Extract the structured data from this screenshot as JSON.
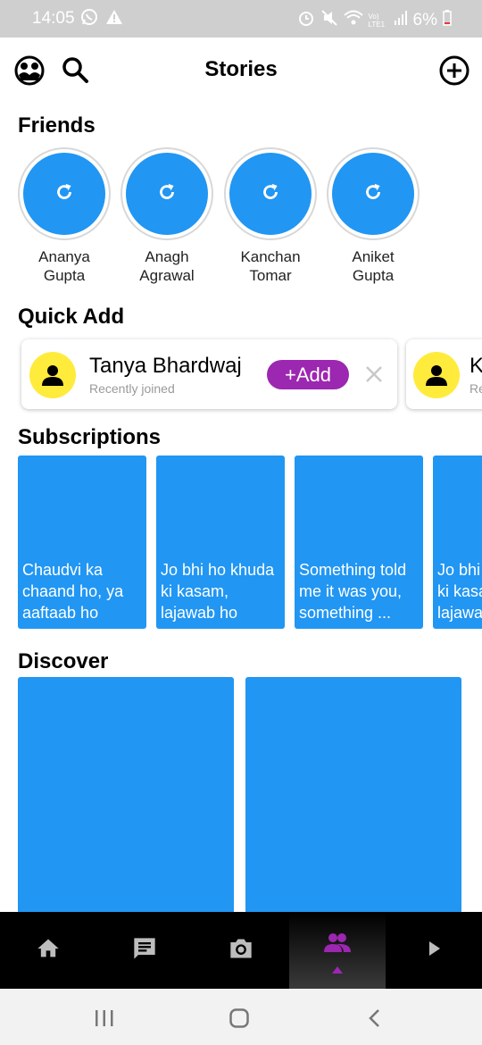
{
  "status_bar": {
    "time": "14:05",
    "network_label": "Vo) LTE1",
    "battery": "6%"
  },
  "header": {
    "title": "Stories"
  },
  "friends": {
    "title": "Friends",
    "items": [
      {
        "first": "Ananya",
        "last": "Gupta"
      },
      {
        "first": "Anagh",
        "last": "Agrawal"
      },
      {
        "first": "Kanchan",
        "last": "Tomar"
      },
      {
        "first": "Aniket",
        "last": "Gupta"
      }
    ]
  },
  "quick_add": {
    "title": "Quick Add",
    "cards": [
      {
        "name": "Tanya Bhardwaj",
        "subtitle": "Recently joined",
        "button": "+Add"
      },
      {
        "name": "K",
        "subtitle": "Re"
      }
    ]
  },
  "subscriptions": {
    "title": "Subscriptions",
    "tiles": [
      {
        "caption": "Chaudvi ka chaand ho, ya aaftaab ho"
      },
      {
        "caption": "Jo bhi ho khuda ki kasam, lajawab ho"
      },
      {
        "caption": "Something told me it was you, something ..."
      },
      {
        "caption": "Jo bhi ho khuda ki kasam, lajawab ho"
      }
    ]
  },
  "discover": {
    "title": "Discover"
  },
  "colors": {
    "accent": "#2196f3",
    "add_button": "#9c27b0",
    "avatar": "#ffeb3b",
    "nav_active": "#9c27b0"
  },
  "bottom_nav": [
    "home-icon",
    "chat-icon",
    "camera-icon",
    "friends-icon",
    "play-icon"
  ]
}
